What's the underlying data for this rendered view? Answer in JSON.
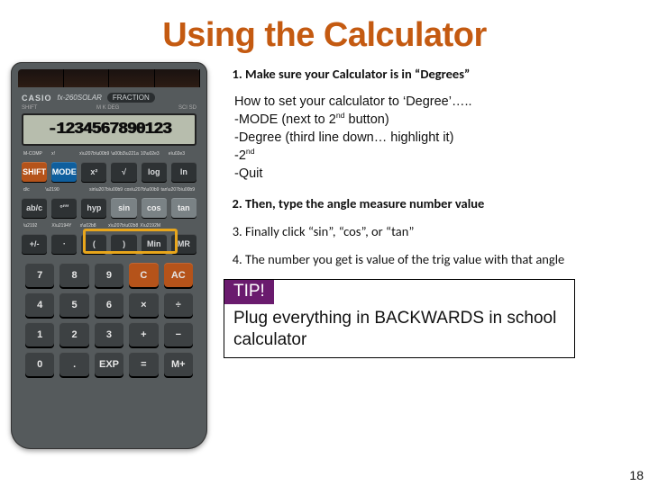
{
  "title": "Using the Calculator",
  "steps": [
    "Make sure your Calculator is in “Degrees”",
    "Then, type the angle measure number value",
    "Finally click “sin”, “cos”, or “tan”",
    "The number you get is value of the trig value with that angle"
  ],
  "howto": {
    "heading": "How to set your calculator to ‘Degree’…..",
    "l1a": "-MODE (next to 2",
    "l1sup": "nd",
    "l1b": " button)",
    "l2": "-Degree (third line down… highlight it)",
    "l3a": "-2",
    "l3sup": "nd",
    "l4": "-Quit"
  },
  "tip": {
    "badge": "TIP!",
    "body": "Plug everything in BACKWARDS in school calculator"
  },
  "page": "18",
  "calc": {
    "brand_casio": "CASIO",
    "brand_model": "fx-260SOLAR",
    "brand_frac": "FRACTION",
    "tiny_l": "SHIFT",
    "tiny_m": "M  K  DEG",
    "tiny_r": "SCI SD",
    "lcd": "-1234567890123",
    "row1": [
      "SHIFT",
      "MODE",
      "x²",
      "√",
      "log",
      "ln"
    ],
    "row2": [
      "ab/c",
      "°′″",
      "hyp",
      "sin",
      "cos",
      "tan"
    ],
    "row3": [
      "+/-",
      "‧",
      "(",
      ")",
      "Min",
      "MR"
    ],
    "num": [
      [
        "7",
        "8",
        "9",
        "C",
        "AC"
      ],
      [
        "4",
        "5",
        "6",
        "×",
        "÷"
      ],
      [
        "1",
        "2",
        "3",
        "+",
        "−"
      ],
      [
        "0",
        ".",
        "EXP",
        "=",
        "M+"
      ]
    ]
  }
}
